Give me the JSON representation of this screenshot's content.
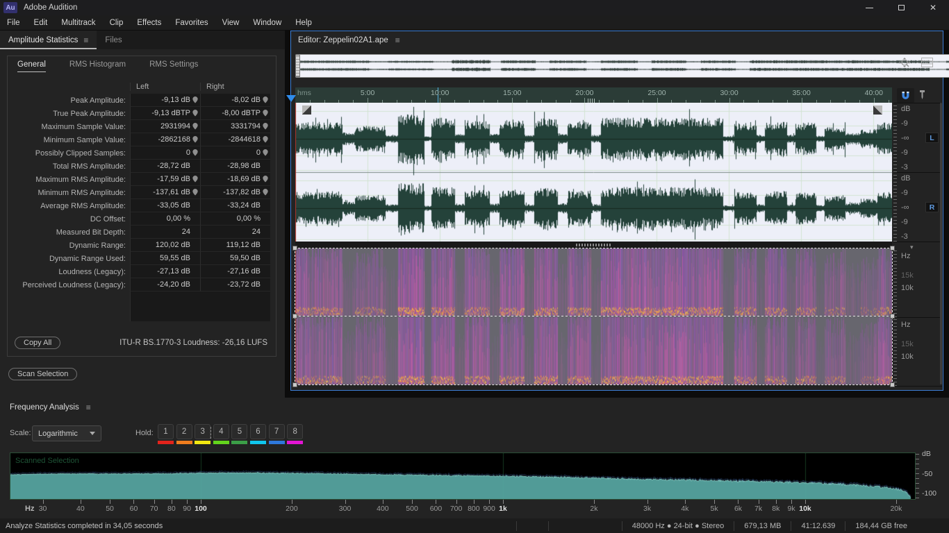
{
  "window": {
    "logo": "Au",
    "title": "Adobe Audition"
  },
  "menu": {
    "items": [
      "File",
      "Edit",
      "Multitrack",
      "Clip",
      "Effects",
      "Favorites",
      "View",
      "Window",
      "Help"
    ]
  },
  "stats_panel": {
    "menu_icon": "≡",
    "tabs": [
      {
        "label": "Amplitude Statistics",
        "active": true
      },
      {
        "label": "Files",
        "active": false
      }
    ],
    "subtabs": [
      {
        "label": "General",
        "active": true
      },
      {
        "label": "RMS Histogram",
        "active": false
      },
      {
        "label": "RMS Settings",
        "active": false
      }
    ],
    "columns": {
      "left": "Left",
      "right": "Right"
    },
    "rows": [
      {
        "label": "Peak Amplitude:",
        "left": "-9,13 dB",
        "right": "-8,02 dB",
        "pin": true
      },
      {
        "label": "True Peak Amplitude:",
        "left": "-9,13 dBTP",
        "right": "-8,00 dBTP",
        "pin": true
      },
      {
        "label": "Maximum Sample Value:",
        "left": "2931994",
        "right": "3331794",
        "pin": true
      },
      {
        "label": "Minimum Sample Value:",
        "left": "-2862168",
        "right": "-2844618",
        "pin": true
      },
      {
        "label": "Possibly Clipped Samples:",
        "left": "0",
        "right": "0",
        "pin": true
      },
      {
        "label": "Total RMS Amplitude:",
        "left": "-28,72 dB",
        "right": "-28,98 dB",
        "pin": false
      },
      {
        "label": "Maximum RMS Amplitude:",
        "left": "-17,59 dB",
        "right": "-18,69 dB",
        "pin": true
      },
      {
        "label": "Minimum RMS Amplitude:",
        "left": "-137,61 dB",
        "right": "-137,82 dB",
        "pin": true
      },
      {
        "label": "Average RMS Amplitude:",
        "left": "-33,05 dB",
        "right": "-33,24 dB",
        "pin": false
      },
      {
        "label": "DC Offset:",
        "left": "0,00 %",
        "right": "0,00 %",
        "pin": false
      },
      {
        "label": "Measured Bit Depth:",
        "left": "24",
        "right": "24",
        "pin": false
      },
      {
        "label": "Dynamic Range:",
        "left": "120,02 dB",
        "right": "119,12 dB",
        "pin": false
      },
      {
        "label": "Dynamic Range Used:",
        "left": "59,55 dB",
        "right": "59,50 dB",
        "pin": false
      },
      {
        "label": "Loudness (Legacy):",
        "left": "-27,13 dB",
        "right": "-27,16 dB",
        "pin": false
      },
      {
        "label": "Perceived Loudness (Legacy):",
        "left": "-24,20 dB",
        "right": "-23,72 dB",
        "pin": false
      }
    ],
    "copy_all": "Copy All",
    "loudness_note": "ITU-R BS.1770-3 Loudness:  -26,16 LUFS",
    "scan_selection": "Scan Selection"
  },
  "editor": {
    "title": "Editor: Zeppelin02A1.ape",
    "menu_icon": "≡",
    "ruler": {
      "unit": "hms",
      "labels": [
        "5:00",
        "10:00",
        "15:00",
        "20:00",
        "25:00",
        "30:00",
        "35:00",
        "40:00"
      ]
    },
    "amplitude_scale": {
      "unit": "dB",
      "labels": [
        "-9",
        "-∞",
        "-9",
        "-3"
      ]
    },
    "frequency_scale": {
      "unit": "Hz",
      "labels": [
        "15k",
        "10k"
      ]
    },
    "channel_badges": [
      "L",
      "R"
    ]
  },
  "freq_panel": {
    "title": "Frequency Analysis",
    "menu_icon": "≡",
    "scale_label": "Scale:",
    "scale_value": "Logarithmic",
    "hold_label": "Hold:",
    "hold_buttons": [
      {
        "label": "1",
        "color": "#e3231b"
      },
      {
        "label": "2",
        "color": "#f07d1e"
      },
      {
        "label": "3",
        "color": "#f2e711"
      },
      {
        "label": "4",
        "color": "#63d41c"
      },
      {
        "label": "5",
        "color": "#3b9e47"
      },
      {
        "label": "6",
        "color": "#10c6ee"
      },
      {
        "label": "7",
        "color": "#2e78dc"
      },
      {
        "label": "8",
        "color": "#e315d4"
      }
    ]
  },
  "chart_data": {
    "type": "area",
    "title": "Frequency Analysis",
    "overlay_label": "Scanned Selection",
    "x_scale": "logarithmic",
    "xlabel": "Hz",
    "ylabel": "dB",
    "xlim": [
      20,
      23000
    ],
    "ylim": [
      -107,
      10
    ],
    "x_ticks": [
      {
        "label": "30",
        "f": 30
      },
      {
        "label": "40",
        "f": 40
      },
      {
        "label": "50",
        "f": 50
      },
      {
        "label": "60",
        "f": 60
      },
      {
        "label": "70",
        "f": 70
      },
      {
        "label": "80",
        "f": 80
      },
      {
        "label": "90",
        "f": 90
      },
      {
        "label": "100",
        "f": 100,
        "major": true
      },
      {
        "label": "200",
        "f": 200
      },
      {
        "label": "300",
        "f": 300
      },
      {
        "label": "400",
        "f": 400
      },
      {
        "label": "500",
        "f": 500
      },
      {
        "label": "600",
        "f": 600
      },
      {
        "label": "700",
        "f": 700
      },
      {
        "label": "800",
        "f": 800
      },
      {
        "label": "900",
        "f": 900
      },
      {
        "label": "1k",
        "f": 1000,
        "major": true
      },
      {
        "label": "2k",
        "f": 2000
      },
      {
        "label": "3k",
        "f": 3000
      },
      {
        "label": "4k",
        "f": 4000
      },
      {
        "label": "5k",
        "f": 5000
      },
      {
        "label": "6k",
        "f": 6000
      },
      {
        "label": "7k",
        "f": 7000
      },
      {
        "label": "8k",
        "f": 8000
      },
      {
        "label": "9k",
        "f": 9000
      },
      {
        "label": "10k",
        "f": 10000,
        "major": true
      },
      {
        "label": "20k",
        "f": 20000
      }
    ],
    "y_ticks": [
      {
        "label": "-50",
        "db": -50
      },
      {
        "label": "-100",
        "db": -100
      }
    ],
    "series": [
      {
        "name": "Scanned Selection",
        "points": [
          [
            20,
            -46
          ],
          [
            30,
            -43
          ],
          [
            50,
            -42.5
          ],
          [
            80,
            -42
          ],
          [
            100,
            -40.5
          ],
          [
            150,
            -40
          ],
          [
            200,
            -41
          ],
          [
            300,
            -43
          ],
          [
            400,
            -44.5
          ],
          [
            500,
            -45.5
          ],
          [
            700,
            -47
          ],
          [
            1000,
            -48.5
          ],
          [
            1500,
            -51
          ],
          [
            2000,
            -53
          ],
          [
            3000,
            -56.5
          ],
          [
            4000,
            -58.5
          ],
          [
            5000,
            -60
          ],
          [
            6000,
            -61
          ],
          [
            7000,
            -62
          ],
          [
            8000,
            -63.5
          ],
          [
            9000,
            -64.5
          ],
          [
            10000,
            -65.5
          ],
          [
            12000,
            -68
          ],
          [
            15000,
            -72
          ],
          [
            18000,
            -77
          ],
          [
            20000,
            -81
          ],
          [
            21500,
            -88
          ],
          [
            22300,
            -100
          ]
        ]
      }
    ],
    "grid": true,
    "legend": false,
    "fill_color": "#57a7a2",
    "line_color": "#8ad2cb",
    "background": "#000000",
    "grid_color": "#16381f"
  },
  "status_bar": {
    "message": "Analyze Statistics completed in 34,05 seconds",
    "format": "48000 Hz  ●  24-bit  ●  Stereo",
    "file_size": "679,13 MB",
    "duration": "41:12.639",
    "free_space": "184,44 GB free"
  }
}
